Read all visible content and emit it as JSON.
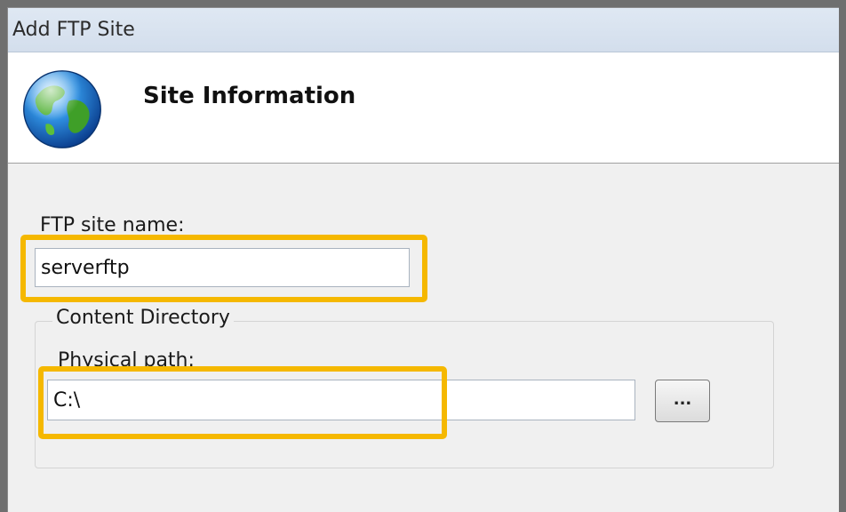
{
  "window": {
    "title": "Add FTP Site"
  },
  "header": {
    "icon": "globe-icon",
    "title": "Site Information"
  },
  "form": {
    "site_name_label": "FTP site name:",
    "site_name_value": "serverftp",
    "content_group_label": "Content Directory",
    "physical_path_label": "Physical path:",
    "physical_path_value": "C:\\",
    "browse_button_label": "..."
  },
  "colors": {
    "highlight": "#f5b800",
    "header_background": "#ffffff",
    "dialog_background": "#f0f0f0",
    "titlebar": "#d9e4f1"
  }
}
